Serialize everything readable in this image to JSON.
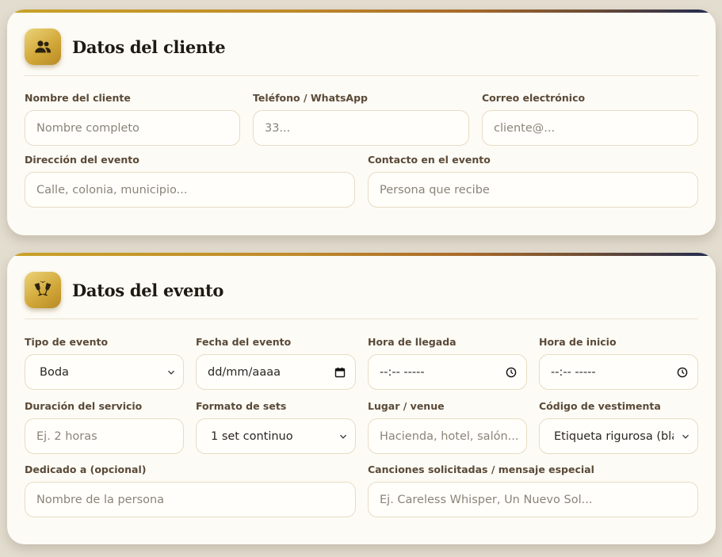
{
  "client_section": {
    "title": "Datos del cliente",
    "icon": "users-icon",
    "fields": {
      "name": {
        "label": "Nombre del cliente",
        "placeholder": "Nombre completo"
      },
      "phone": {
        "label": "Teléfono / WhatsApp",
        "placeholder": "33..."
      },
      "email": {
        "label": "Correo electrónico",
        "placeholder": "cliente@..."
      },
      "address": {
        "label": "Dirección del evento",
        "placeholder": "Calle, colonia, municipio..."
      },
      "contact": {
        "label": "Contacto en el evento",
        "placeholder": "Persona que recibe"
      }
    }
  },
  "event_section": {
    "title": "Datos del evento",
    "icon": "champagne-glasses-icon",
    "fields": {
      "type": {
        "label": "Tipo de evento",
        "value": "Boda"
      },
      "date": {
        "label": "Fecha del evento",
        "value": "dd/mm/aaaa"
      },
      "arrival": {
        "label": "Hora de llegada",
        "value": "--:-- -----"
      },
      "start": {
        "label": "Hora de inicio",
        "value": "--:-- -----"
      },
      "duration": {
        "label": "Duración del servicio",
        "placeholder": "Ej. 2 horas"
      },
      "sets": {
        "label": "Formato de sets",
        "value": "1 set continuo"
      },
      "venue": {
        "label": "Lugar / venue",
        "placeholder": "Hacienda, hotel, salón..."
      },
      "dress": {
        "label": "Código de vestimenta",
        "value": "Etiqueta rigurosa (bla"
      },
      "dedicated": {
        "label": "Dedicado a (opcional)",
        "placeholder": "Nombre de la persona"
      },
      "songs": {
        "label": "Canciones solicitadas / mensaje especial",
        "placeholder": "Ej. Careless Whisper, Un Nuevo Sol..."
      }
    }
  },
  "colors": {
    "accent_gold": "#d2a93a",
    "accent_navy": "#1f2a4f",
    "card_bg": "#fdfbf5",
    "page_bg": "#e3ddd0"
  }
}
